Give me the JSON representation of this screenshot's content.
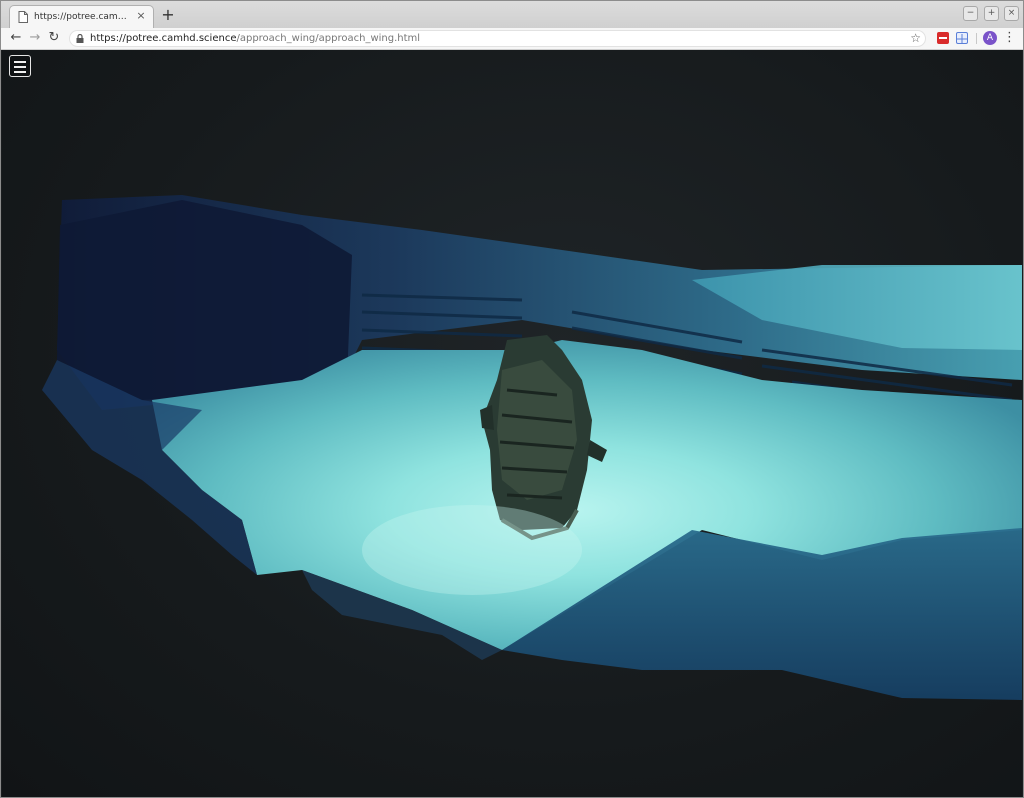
{
  "browser": {
    "tab": {
      "title": "https://potree.camhd.science/a",
      "close_glyph": "×",
      "favicon": "document-icon"
    },
    "new_tab_glyph": "+",
    "window_controls": {
      "minimize": "−",
      "maximize": "+",
      "close": "×"
    },
    "nav": {
      "back": "←",
      "forward": "→",
      "reload": "↻"
    },
    "address": {
      "host": "https://potree.camhd.science",
      "path": "/approach_wing/approach_wing.html"
    },
    "star_glyph": "☆",
    "profile_initial": "A",
    "menu_glyph": "⋮",
    "colors": {
      "extension_red": "#d92b2b",
      "extension_blue": "#5a7fd8",
      "avatar": "#7a53c9"
    }
  },
  "viewer": {
    "menu_icon": "hamburger-icon",
    "colors": {
      "background": "#161a1c",
      "seafloor_light": "#8fe8e4",
      "seafloor_mid": "#4fb0b8",
      "seafloor_dark": "#1f4a6a"
    }
  }
}
